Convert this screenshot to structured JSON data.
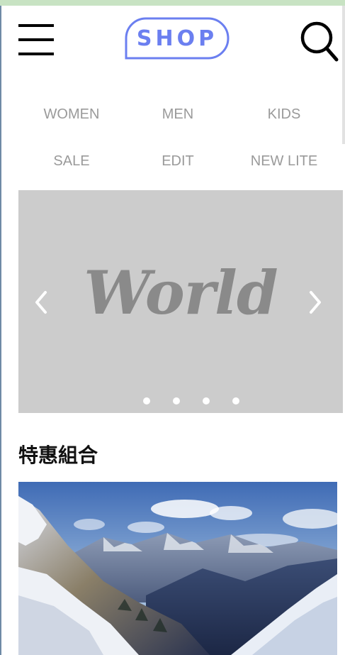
{
  "header": {
    "logo_text": "SHOP",
    "menu_icon": "hamburger-menu-icon",
    "search_icon": "search-icon",
    "accent_color": "#6b7ff0"
  },
  "nav": {
    "items": [
      {
        "label": "WOMEN"
      },
      {
        "label": "MEN"
      },
      {
        "label": "KIDS"
      },
      {
        "label": "SALE"
      },
      {
        "label": "EDIT"
      },
      {
        "label": "NEW LITE"
      }
    ]
  },
  "carousel": {
    "slide_text": "World",
    "prev_icon": "chevron-left-icon",
    "next_icon": "chevron-right-icon",
    "dot_count": 4,
    "active_index": 0
  },
  "section": {
    "title": "特惠組合"
  }
}
